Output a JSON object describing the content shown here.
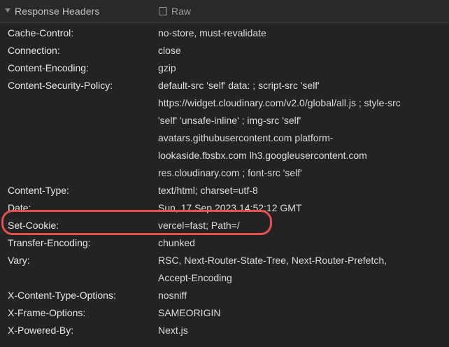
{
  "section": {
    "title": "Response Headers",
    "raw_label": "Raw",
    "raw_checked": false
  },
  "headers": [
    {
      "name": "Cache-Control:",
      "value_lines": [
        "no-store, must-revalidate"
      ]
    },
    {
      "name": "Connection:",
      "value_lines": [
        "close"
      ]
    },
    {
      "name": "Content-Encoding:",
      "value_lines": [
        "gzip"
      ]
    },
    {
      "name": "Content-Security-Policy:",
      "value_lines": [
        "default-src 'self' data: ; script-src 'self'",
        "https://widget.cloudinary.com/v2.0/global/all.js ; style-src",
        "'self' 'unsafe-inline' ; img-src 'self'",
        "avatars.githubusercontent.com platform-",
        "lookaside.fbsbx.com lh3.googleusercontent.com",
        "res.cloudinary.com ; font-src 'self'"
      ]
    },
    {
      "name": "Content-Type:",
      "value_lines": [
        "text/html; charset=utf-8"
      ]
    },
    {
      "name": "Date:",
      "value_lines": [
        "Sun, 17 Sep 2023 14:52:12 GMT"
      ]
    },
    {
      "name": "Set-Cookie:",
      "value_lines": [
        "vercel=fast; Path=/"
      ]
    },
    {
      "name": "Transfer-Encoding:",
      "value_lines": [
        "chunked"
      ]
    },
    {
      "name": "Vary:",
      "value_lines": [
        "RSC, Next-Router-State-Tree, Next-Router-Prefetch,",
        "Accept-Encoding"
      ]
    },
    {
      "name": "X-Content-Type-Options:",
      "value_lines": [
        "nosniff"
      ]
    },
    {
      "name": "X-Frame-Options:",
      "value_lines": [
        "SAMEORIGIN"
      ]
    },
    {
      "name": "X-Powered-By:",
      "value_lines": [
        "Next.js"
      ]
    }
  ],
  "highlight_color": "#e8504f"
}
